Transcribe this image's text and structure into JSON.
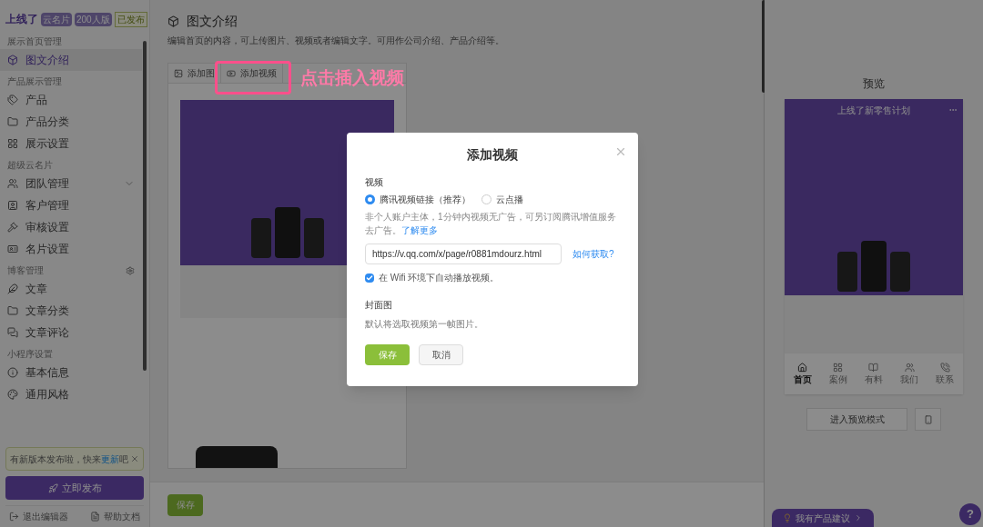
{
  "sidebar": {
    "logo": "上线了",
    "badges": [
      "云名片",
      "200人版"
    ],
    "status": "已发布",
    "sections": [
      {
        "title": "展示首页管理",
        "items": [
          {
            "label": "图文介绍",
            "selected": true
          }
        ]
      },
      {
        "title": "产品展示管理",
        "items": [
          {
            "label": "产品",
            "selected": false
          },
          {
            "label": "产品分类",
            "selected": false
          },
          {
            "label": "展示设置",
            "selected": false
          }
        ]
      },
      {
        "title": "超级云名片",
        "items": [
          {
            "label": "团队管理",
            "selected": false,
            "expanded": false
          },
          {
            "label": "客户管理",
            "selected": false
          },
          {
            "label": "审核设置",
            "selected": false
          },
          {
            "label": "名片设置",
            "selected": false
          }
        ]
      },
      {
        "title": "博客管理",
        "items": [
          {
            "label": "文章",
            "selected": false
          },
          {
            "label": "文章分类",
            "selected": false
          },
          {
            "label": "文章评论",
            "selected": false
          }
        ]
      },
      {
        "title": "小程序设置",
        "items": [
          {
            "label": "基本信息",
            "selected": false
          },
          {
            "label": "通用风格",
            "selected": false
          }
        ]
      }
    ],
    "notice": {
      "before": "有新版本发布啦，快来",
      "link": "更新",
      "after": "吧"
    },
    "publish_button": "立即发布",
    "footer": [
      "退出编辑器",
      "帮助文档"
    ]
  },
  "main": {
    "title": "图文介绍",
    "description": "编辑首页的内容，可上传图片、视频或者编辑文字。可用作公司介绍、产品介绍等。",
    "tabs": [
      "添加图",
      "添加视频"
    ],
    "annotation": "点击插入视频",
    "save_button": "保存"
  },
  "preview": {
    "title": "预览",
    "app_title": "上线了新零售计划",
    "nav": [
      {
        "label": "首页",
        "selected": true
      },
      {
        "label": "案例",
        "selected": false
      },
      {
        "label": "有料",
        "selected": false
      },
      {
        "label": "我们",
        "selected": false
      },
      {
        "label": "联系",
        "selected": false
      }
    ],
    "preview_button": "进入预览模式",
    "feedback": "我有产品建议",
    "help": "?"
  },
  "dialog": {
    "title": "添加视频",
    "video_label": "视频",
    "options": [
      {
        "label": "腾讯视频链接（推荐）",
        "selected": true
      },
      {
        "label": "云点播",
        "selected": false
      }
    ],
    "hint": "非个人账户主体，1分钟内视频无广告，可另订阅腾讯增值服务去广告。",
    "hint_link": "了解更多",
    "url": "https://v.qq.com/x/page/r0881mdourz.html",
    "how_link": "如何获取?",
    "autoplay": {
      "label": "在 Wifi 环境下自动播放视频。",
      "checked": true
    },
    "cover_label": "封面图",
    "cover_hint": "默认将选取视频第一帧图片。",
    "buttons": [
      {
        "label": "保存",
        "kind": "primary"
      },
      {
        "label": "取消",
        "kind": "secondary"
      }
    ]
  }
}
